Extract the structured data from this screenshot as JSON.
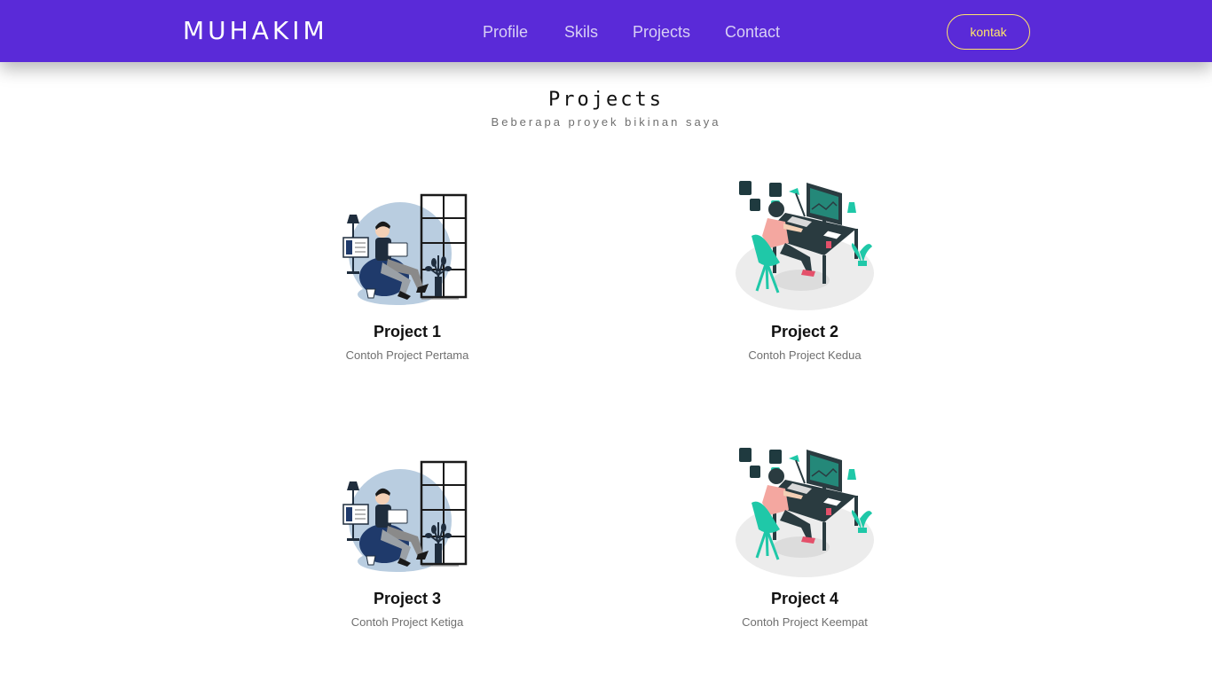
{
  "navbar": {
    "brand": "MUHAKIM",
    "links": [
      {
        "label": "Profile"
      },
      {
        "label": "Skils"
      },
      {
        "label": "Projects"
      },
      {
        "label": "Contact"
      }
    ],
    "button_label": "kontak"
  },
  "projects": {
    "title": "Projects",
    "subtitle": "Beberapa proyek bikinan saya",
    "items": [
      {
        "title": "Project 1",
        "description": "Contoh Project Pertama",
        "illustration": "reading-man-illustration"
      },
      {
        "title": "Project 2",
        "description": "Contoh Project Kedua",
        "illustration": "designer-desk-illustration"
      },
      {
        "title": "Project 3",
        "description": "Contoh Project Ketiga",
        "illustration": "reading-man-illustration"
      },
      {
        "title": "Project 4",
        "description": "Contoh Project Keempat",
        "illustration": "designer-desk-illustration"
      }
    ]
  },
  "colors": {
    "navbar_bg": "#5a2ad8",
    "button_accent": "#ffe46a",
    "nav_link": "#d8d0f5",
    "teal_accent": "#1fc8a8",
    "navy_accent": "#1f3a6b"
  }
}
